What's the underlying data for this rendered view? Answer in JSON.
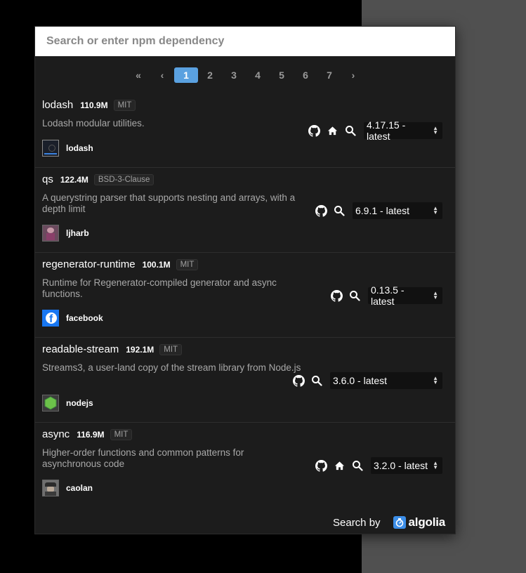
{
  "search": {
    "placeholder": "Search or enter npm dependency"
  },
  "pagination": {
    "first": "«",
    "prev": "‹",
    "pages": [
      "1",
      "2",
      "3",
      "4",
      "5",
      "6",
      "7"
    ],
    "current": "1",
    "next": "›"
  },
  "results": [
    {
      "name": "lodash",
      "downloads": "110.9M",
      "license": "MIT",
      "description": "Lodash modular utilities.",
      "owner": "lodash",
      "version": "4.17.15 - latest",
      "icons": [
        "github-icon",
        "home-icon",
        "search-icon"
      ]
    },
    {
      "name": "qs",
      "downloads": "122.4M",
      "license": "BSD-3-Clause",
      "description": "A querystring parser that supports nesting and arrays, with a depth limit",
      "owner": "ljharb",
      "version": "6.9.1 - latest",
      "icons": [
        "github-icon",
        "search-icon"
      ]
    },
    {
      "name": "regenerator-runtime",
      "downloads": "100.1M",
      "license": "MIT",
      "description": "Runtime for Regenerator-compiled generator and async functions.",
      "owner": "facebook",
      "version": "0.13.5 - latest",
      "icons": [
        "github-icon",
        "search-icon"
      ]
    },
    {
      "name": "readable-stream",
      "downloads": "192.1M",
      "license": "MIT",
      "description": "Streams3, a user-land copy of the stream library from Node.js",
      "owner": "nodejs",
      "version": "3.6.0 - latest",
      "icons": [
        "github-icon",
        "search-icon"
      ]
    },
    {
      "name": "async",
      "downloads": "116.9M",
      "license": "MIT",
      "description": "Higher-order functions and common patterns for asynchronous code",
      "owner": "caolan",
      "version": "3.2.0 - latest",
      "icons": [
        "github-icon",
        "home-icon",
        "search-icon"
      ]
    }
  ],
  "footer": {
    "search_by": "Search by",
    "brand": "algolia"
  },
  "colors": {
    "accent": "#5aa1e0",
    "algolia": "#3c8ee8",
    "background": "#1c1c1c"
  }
}
